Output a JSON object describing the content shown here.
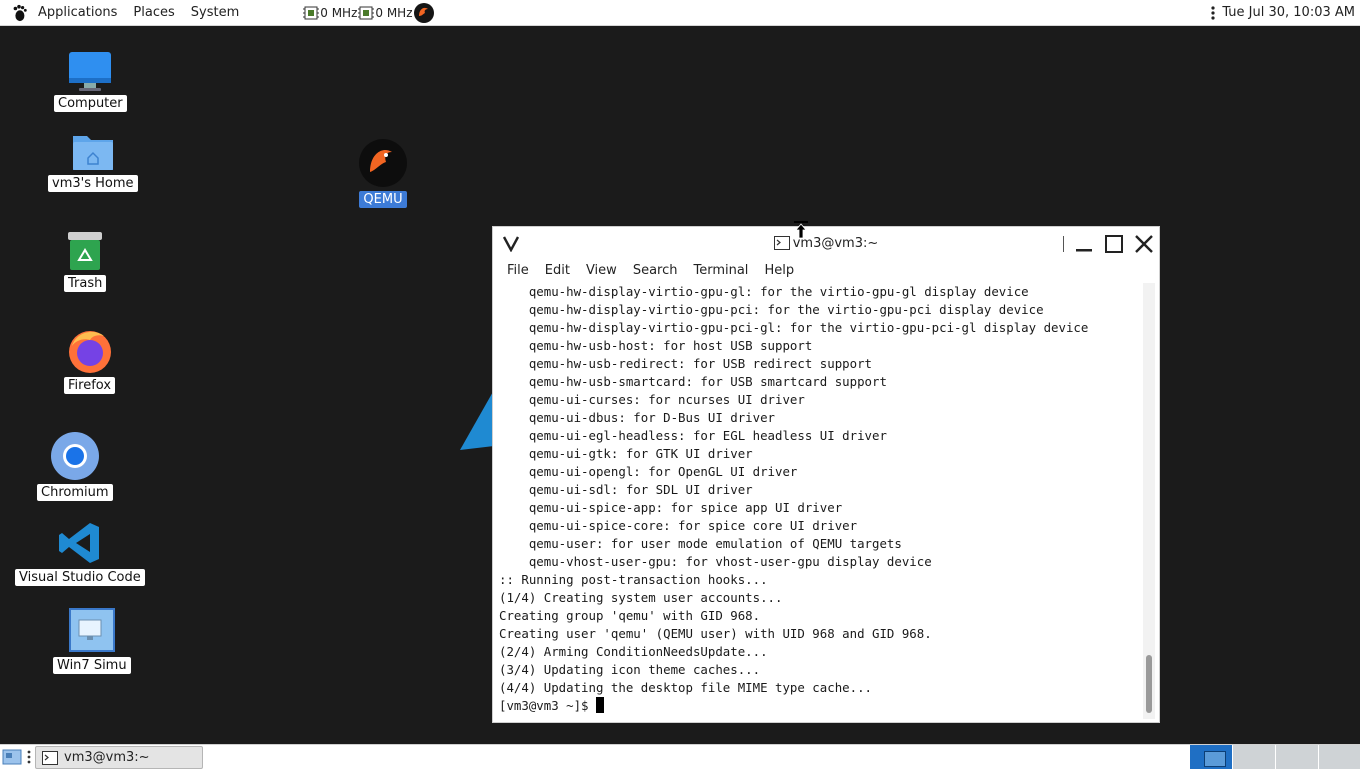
{
  "top_panel": {
    "menus": [
      "Applications",
      "Places",
      "System"
    ],
    "cpu": [
      {
        "freq": "0 MHz"
      },
      {
        "freq": "0 MHz"
      }
    ],
    "clock": "Tue Jul 30, 10:03 AM"
  },
  "desktop": {
    "icons": {
      "computer": "Computer",
      "home": "vm3's Home",
      "trash": "Trash",
      "firefox": "Firefox",
      "chromium": "Chromium",
      "vscode": "Visual Studio Code",
      "win7": "Win7 Simu",
      "qemu": "QEMU"
    }
  },
  "terminal": {
    "title": "vm3@vm3:~",
    "menu": [
      "File",
      "Edit",
      "View",
      "Search",
      "Terminal",
      "Help"
    ],
    "lines": [
      "    qemu-hw-display-virtio-gpu-gl: for the virtio-gpu-gl display device",
      "    qemu-hw-display-virtio-gpu-pci: for the virtio-gpu-pci display device",
      "    qemu-hw-display-virtio-gpu-pci-gl: for the virtio-gpu-pci-gl display device",
      "    qemu-hw-usb-host: for host USB support",
      "    qemu-hw-usb-redirect: for USB redirect support",
      "    qemu-hw-usb-smartcard: for USB smartcard support",
      "    qemu-ui-curses: for ncurses UI driver",
      "    qemu-ui-dbus: for D-Bus UI driver",
      "    qemu-ui-egl-headless: for EGL headless UI driver",
      "    qemu-ui-gtk: for GTK UI driver",
      "    qemu-ui-opengl: for OpenGL UI driver",
      "    qemu-ui-sdl: for SDL UI driver",
      "    qemu-ui-spice-app: for spice app UI driver",
      "    qemu-ui-spice-core: for spice core UI driver",
      "    qemu-user: for user mode emulation of QEMU targets",
      "    qemu-vhost-user-gpu: for vhost-user-gpu display device",
      ":: Running post-transaction hooks...",
      "(1/4) Creating system user accounts...",
      "Creating group 'qemu' with GID 968.",
      "Creating user 'qemu' (QEMU user) with UID 968 and GID 968.",
      "(2/4) Arming ConditionNeedsUpdate...",
      "(3/4) Updating icon theme caches...",
      "(4/4) Updating the desktop file MIME type cache..."
    ],
    "prompt": "[vm3@vm3 ~]$ "
  },
  "bottom_panel": {
    "task": "vm3@vm3:~"
  },
  "colors": {
    "desktop_bg": "#1b1b1b",
    "selection_blue": "#3d7bd6",
    "workspace_active": "#1f6fc4"
  }
}
